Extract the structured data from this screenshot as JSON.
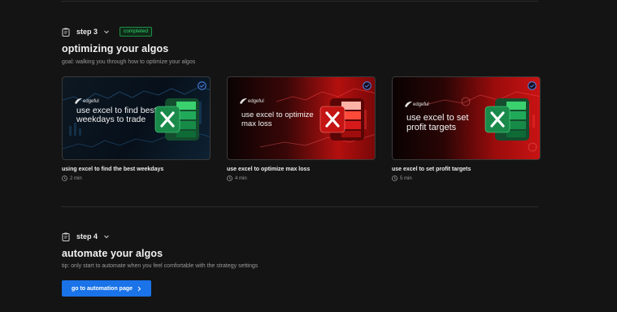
{
  "step3": {
    "label": "step 3",
    "badge": "completed",
    "title": "optimizing your algos",
    "goal": "goal: walking you through how to optimize your algos",
    "cards": [
      {
        "thumb_brand": "edgeful",
        "thumb_text": "use excel to find best weekdays to trade",
        "title": "using excel to find the best weekdays",
        "duration": "2 min",
        "theme": "blue",
        "icon": "excel-icon",
        "checked": true
      },
      {
        "thumb_brand": "edgeful",
        "thumb_text": "use excel to optimize max loss",
        "title": "use excel to optimize max loss",
        "duration": "4 min",
        "theme": "red",
        "icon": "excel-icon",
        "checked": true
      },
      {
        "thumb_brand": "edgeful",
        "thumb_text": "use excel to set profit targets",
        "title": "use excel to set profit targets",
        "duration": "5 min",
        "theme": "red",
        "icon": "excel-icon",
        "checked": true
      }
    ]
  },
  "step4": {
    "label": "step 4",
    "title": "automate your algos",
    "tip": "tip: only start to automate when you feel comfortable with the strategy settings",
    "button_label": "go to automation page"
  },
  "colors": {
    "background": "#141414",
    "accent_blue": "#1a73e8",
    "completed_green": "#2fd46c",
    "excel_green": "#1f9d55"
  }
}
